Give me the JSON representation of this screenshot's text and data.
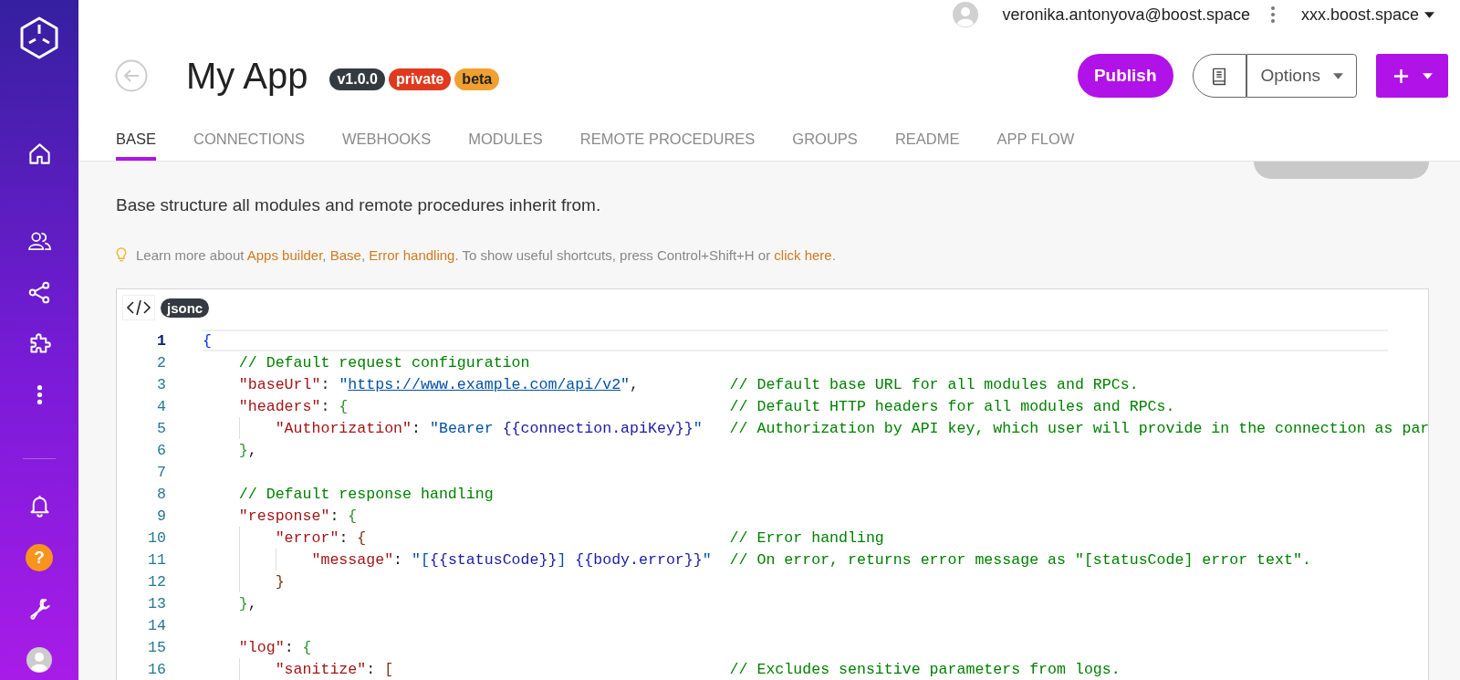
{
  "sidebar": {
    "items": [
      {
        "kind": "home",
        "selected": false
      },
      {
        "kind": "users",
        "selected": false
      },
      {
        "kind": "share",
        "selected": false
      },
      {
        "kind": "puzzle",
        "selected": false
      },
      {
        "kind": "more",
        "selected": false
      }
    ],
    "bottom_items": [
      {
        "kind": "bell"
      },
      {
        "kind": "help",
        "label": "?"
      },
      {
        "kind": "wrench"
      },
      {
        "kind": "avatar"
      }
    ]
  },
  "top_bar": {
    "user_email": "veronika.antonyova@boost.space",
    "workspace": "xxx.boost.space"
  },
  "header": {
    "title": "My App",
    "badges": [
      {
        "label": "v1.0.0",
        "color": "#343a40"
      },
      {
        "label": "private",
        "color": "#e03a1e"
      },
      {
        "label": "beta",
        "color": "#f0a030"
      }
    ],
    "publish_button": "Publish",
    "options_button": "Options"
  },
  "tabs": [
    {
      "label": "BASE",
      "selected": true
    },
    {
      "label": "CONNECTIONS",
      "selected": false
    },
    {
      "label": "WEBHOOKS",
      "selected": false
    },
    {
      "label": "MODULES",
      "selected": false
    },
    {
      "label": "REMOTE PROCEDURES",
      "selected": false
    },
    {
      "label": "GROUPS",
      "selected": false
    },
    {
      "label": "README",
      "selected": false
    },
    {
      "label": "APP FLOW",
      "selected": false
    }
  ],
  "description": "Base structure all modules and remote procedures inherit from.",
  "info": [
    {
      "kind": "text",
      "text": "Learn more about"
    },
    {
      "kind": "link",
      "text": "Apps builder"
    },
    {
      "kind": "text",
      "text": ","
    },
    {
      "kind": "link",
      "text": "Base"
    },
    {
      "kind": "text",
      "text": ","
    },
    {
      "kind": "link",
      "text": "Error handling"
    },
    {
      "kind": "text",
      "text": ". To show useful shortcuts, press Control+Shift+H or"
    },
    {
      "kind": "link",
      "text": "click here"
    },
    {
      "kind": "text",
      "text": "."
    }
  ],
  "editor": {
    "language": "jsonc",
    "lines": [
      {
        "number": "1",
        "active": true,
        "tokens": [
          {
            "kind": "open1",
            "text": "{"
          }
        ]
      },
      {
        "number": "2",
        "active": false,
        "tokens": [
          {
            "kind": "comment",
            "text": "// Default request configuration"
          }
        ]
      },
      {
        "number": "3",
        "active": false,
        "tokens": [
          {
            "kind": "key",
            "text": "\"baseUrl\""
          },
          {
            "kind": "punct",
            "text": ":"
          },
          {
            "kind": "string",
            "text": "\""
          },
          {
            "kind": "link",
            "text": "https://www.example.com/api/v2"
          },
          {
            "kind": "string",
            "text": "\""
          },
          {
            "kind": "punct",
            "text": ","
          }
        ],
        "comment": "// Default base URL for all modules and RPCs."
      },
      {
        "number": "4",
        "active": false,
        "tokens": [
          {
            "kind": "key",
            "text": "\"headers\""
          },
          {
            "kind": "punct",
            "text": ":"
          },
          {
            "kind": "open2",
            "text": "{"
          }
        ],
        "comment": "// Default HTTP headers for all modules and RPCs."
      },
      {
        "number": "5",
        "active": false,
        "tokens": [
          {
            "kind": "key",
            "text": "\"Authorization\""
          },
          {
            "kind": "punct",
            "text": ":"
          },
          {
            "kind": "string",
            "text": "\"Bearer "
          },
          {
            "kind": "template",
            "text": "{{connection.apiKey}}"
          },
          {
            "kind": "string",
            "text": "\""
          }
        ],
        "comment": "// Authorization by API key, which user will provide in the connection as par"
      },
      {
        "number": "6",
        "active": false,
        "tokens": [
          {
            "kind": "close2",
            "text": "}"
          },
          {
            "kind": "punct",
            "text": ","
          }
        ]
      },
      {
        "number": "7",
        "active": false
      },
      {
        "number": "8",
        "active": false,
        "tokens": [
          {
            "kind": "comment",
            "text": "// Default response handling"
          }
        ]
      },
      {
        "number": "9",
        "active": false,
        "tokens": [
          {
            "kind": "key",
            "text": "\"response\""
          },
          {
            "kind": "punct",
            "text": ":"
          },
          {
            "kind": "open2",
            "text": "{"
          }
        ]
      },
      {
        "number": "10",
        "active": false,
        "tokens": [
          {
            "kind": "key",
            "text": "\"error\""
          },
          {
            "kind": "punct",
            "text": ":"
          },
          {
            "kind": "open3",
            "text": "{"
          }
        ],
        "comment": "// Error handling"
      },
      {
        "number": "11",
        "active": false,
        "tokens": [
          {
            "kind": "key",
            "text": "\"message\""
          },
          {
            "kind": "punct",
            "text": ":"
          },
          {
            "kind": "string",
            "text": "\"["
          },
          {
            "kind": "template",
            "text": "{{statusCode}}"
          },
          {
            "kind": "string",
            "text": "] "
          },
          {
            "kind": "template",
            "text": "{{body.error}}"
          },
          {
            "kind": "string",
            "text": "\""
          }
        ],
        "comment": "// On error, returns error message as \"[statusCode] error text\"."
      },
      {
        "number": "12",
        "active": false,
        "tokens": [
          {
            "kind": "close3",
            "text": "}"
          }
        ]
      },
      {
        "number": "13",
        "active": false,
        "tokens": [
          {
            "kind": "close2",
            "text": "}"
          },
          {
            "kind": "punct",
            "text": ","
          }
        ]
      },
      {
        "number": "14",
        "active": false
      },
      {
        "number": "15",
        "active": false,
        "tokens": [
          {
            "kind": "key",
            "text": "\"log\""
          },
          {
            "kind": "punct",
            "text": ":"
          },
          {
            "kind": "open2",
            "text": "{"
          }
        ]
      },
      {
        "number": "16",
        "active": false,
        "tokens": [
          {
            "kind": "key",
            "text": "\"sanitize\""
          },
          {
            "kind": "punct",
            "text": ":"
          },
          {
            "kind": "open3",
            "text": "["
          }
        ],
        "comment": "// Excludes sensitive parameters from logs."
      }
    ]
  }
}
